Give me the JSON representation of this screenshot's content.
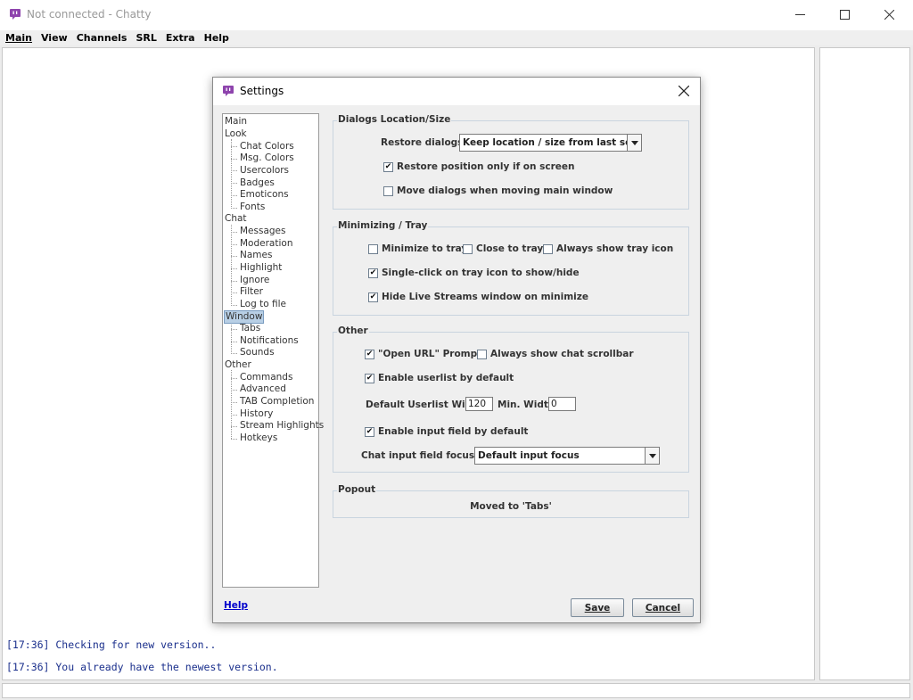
{
  "window": {
    "title": "Not connected - Chatty",
    "icon": "chatty-icon",
    "minimize": "—",
    "maximize": "☐",
    "close": "✕"
  },
  "menu": [
    {
      "label": "Main"
    },
    {
      "label": "View"
    },
    {
      "label": "Channels"
    },
    {
      "label": "SRL"
    },
    {
      "label": "Extra"
    },
    {
      "label": "Help"
    }
  ],
  "chat": {
    "lines": [
      "[17:36] Checking for new version..",
      "[17:36] You already have the newest version."
    ]
  },
  "settings": {
    "title": "Settings",
    "close": "✕",
    "nav": [
      {
        "label": "Main",
        "level": 0
      },
      {
        "label": "Look",
        "level": 0
      },
      {
        "label": "Chat Colors",
        "level": 1
      },
      {
        "label": "Msg. Colors",
        "level": 1
      },
      {
        "label": "Usercolors",
        "level": 1
      },
      {
        "label": "Badges",
        "level": 1
      },
      {
        "label": "Emoticons",
        "level": 1
      },
      {
        "label": "Fonts",
        "level": 1
      },
      {
        "label": "Chat",
        "level": 0
      },
      {
        "label": "Messages",
        "level": 1
      },
      {
        "label": "Moderation",
        "level": 1
      },
      {
        "label": "Names",
        "level": 1
      },
      {
        "label": "Highlight",
        "level": 1
      },
      {
        "label": "Ignore",
        "level": 1
      },
      {
        "label": "Filter",
        "level": 1
      },
      {
        "label": "Log to file",
        "level": 1
      },
      {
        "label": "Window",
        "level": 0,
        "selected": true
      },
      {
        "label": "Tabs",
        "level": 1
      },
      {
        "label": "Notifications",
        "level": 1
      },
      {
        "label": "Sounds",
        "level": 1
      },
      {
        "label": "Other",
        "level": 0
      },
      {
        "label": "Commands",
        "level": 1
      },
      {
        "label": "Advanced",
        "level": 1
      },
      {
        "label": "TAB Completion",
        "level": 1
      },
      {
        "label": "History",
        "level": 1
      },
      {
        "label": "Stream Highlights",
        "level": 1
      },
      {
        "label": "Hotkeys",
        "level": 1
      }
    ],
    "help": "Help",
    "save": "Save",
    "cancel": "Cancel",
    "dialogs": {
      "title": "Dialogs Location/Size",
      "restore_label": "Restore dialogs:",
      "restore_value": "Keep location / size from last session",
      "restore_on_screen": {
        "label": "Restore position only if on screen",
        "checked": true
      },
      "move_dialogs": {
        "label": "Move dialogs when moving main window",
        "checked": false
      }
    },
    "tray": {
      "title": "Minimizing / Tray",
      "minimize_to_tray": {
        "label": "Minimize to tray",
        "checked": false
      },
      "close_to_tray": {
        "label": "Close to tray",
        "checked": false
      },
      "always_tray_icon": {
        "label": "Always show tray icon",
        "checked": false
      },
      "single_click": {
        "label": "Single-click on tray icon to show/hide",
        "checked": true
      },
      "hide_live_streams": {
        "label": "Hide Live Streams window on minimize",
        "checked": true
      }
    },
    "other": {
      "title": "Other",
      "open_url": {
        "label": "\"Open URL\" Prompt",
        "checked": true
      },
      "scrollbar": {
        "label": "Always show chat scrollbar",
        "checked": false
      },
      "userlist": {
        "label": "Enable userlist by default",
        "checked": true
      },
      "userlist_width_label": "Default Userlist Width:",
      "userlist_width": "120",
      "min_width_label": "Min. Width:",
      "min_width": "0",
      "input_field": {
        "label": "Enable input field by default",
        "checked": true
      },
      "focus_label": "Chat input field focus:",
      "focus_value": "Default input focus"
    },
    "popout": {
      "title": "Popout",
      "text": "Moved to 'Tabs'"
    },
    "check_mark": "✔"
  }
}
